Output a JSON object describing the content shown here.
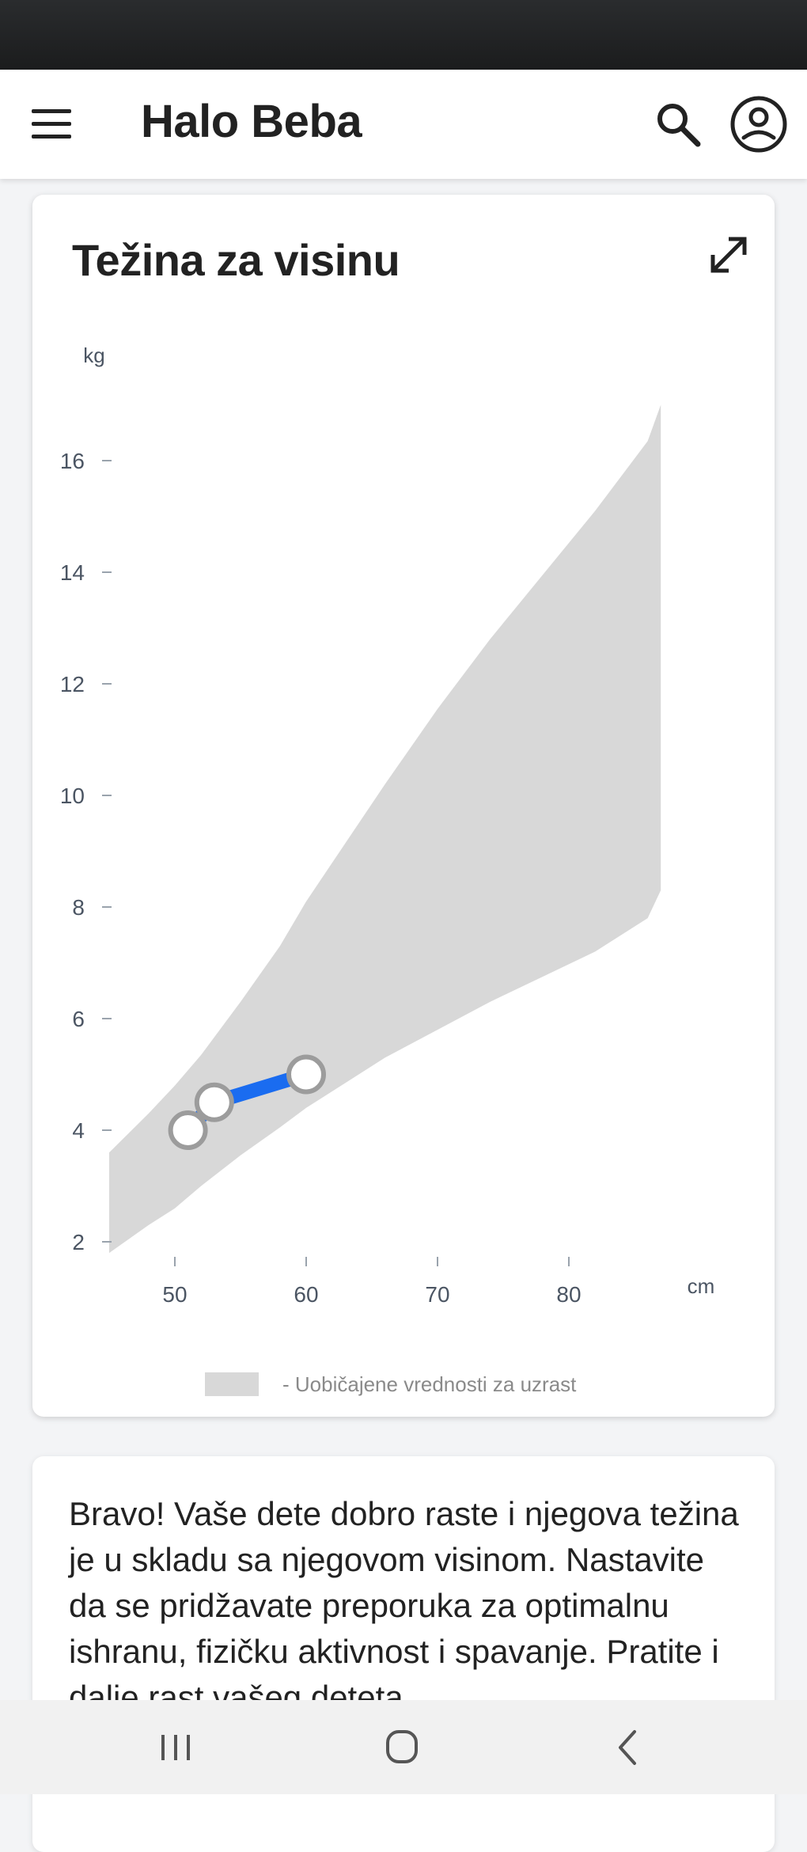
{
  "app": {
    "title": "Halo Beba"
  },
  "header": {
    "menu_icon": "hamburger-menu-icon",
    "search_icon": "search-icon",
    "account_icon": "account-circle-icon"
  },
  "chart_card": {
    "title": "Težina za visinu",
    "expand_icon": "expand-diagonal-icon",
    "legend_label": "- Uobičajene vrednosti za uzrast"
  },
  "chart_data": {
    "type": "line",
    "xlabel": "cm",
    "ylabel": "kg",
    "xlim": [
      45,
      90
    ],
    "ylim": [
      2,
      17
    ],
    "x_ticks": [
      50,
      60,
      70,
      80
    ],
    "y_ticks": [
      2,
      4,
      6,
      8,
      10,
      12,
      14,
      16
    ],
    "normal_range_band": {
      "x": [
        45,
        48,
        50,
        52,
        55,
        58,
        60,
        63,
        66,
        70,
        74,
        78,
        82,
        86,
        87
      ],
      "lower": [
        1.8,
        2.3,
        2.6,
        3.0,
        3.55,
        4.05,
        4.4,
        4.85,
        5.3,
        5.8,
        6.3,
        6.75,
        7.2,
        7.8,
        8.3
      ],
      "upper": [
        3.6,
        4.3,
        4.8,
        5.35,
        6.3,
        7.3,
        8.1,
        9.15,
        10.2,
        11.55,
        12.8,
        13.95,
        15.1,
        16.35,
        17.0
      ],
      "color": "#d8d8d8"
    },
    "series": [
      {
        "x": [
          51,
          53,
          60
        ],
        "y": [
          4.0,
          4.5,
          5.0
        ],
        "color": "#1a6cf0"
      }
    ]
  },
  "info_card": {
    "text": "Bravo! Vaše dete dobro raste i njegova težina je u skladu sa njegovom visinom. Nastavite da se pridžavate preporuka za optimalnu ishranu, fizičku aktivnost i spavanje. Pratite i dalje rast vašeg deteta."
  },
  "nav": {
    "recents_icon": "recent-apps-icon",
    "home_icon": "home-icon",
    "back_icon": "back-chevron-icon"
  }
}
